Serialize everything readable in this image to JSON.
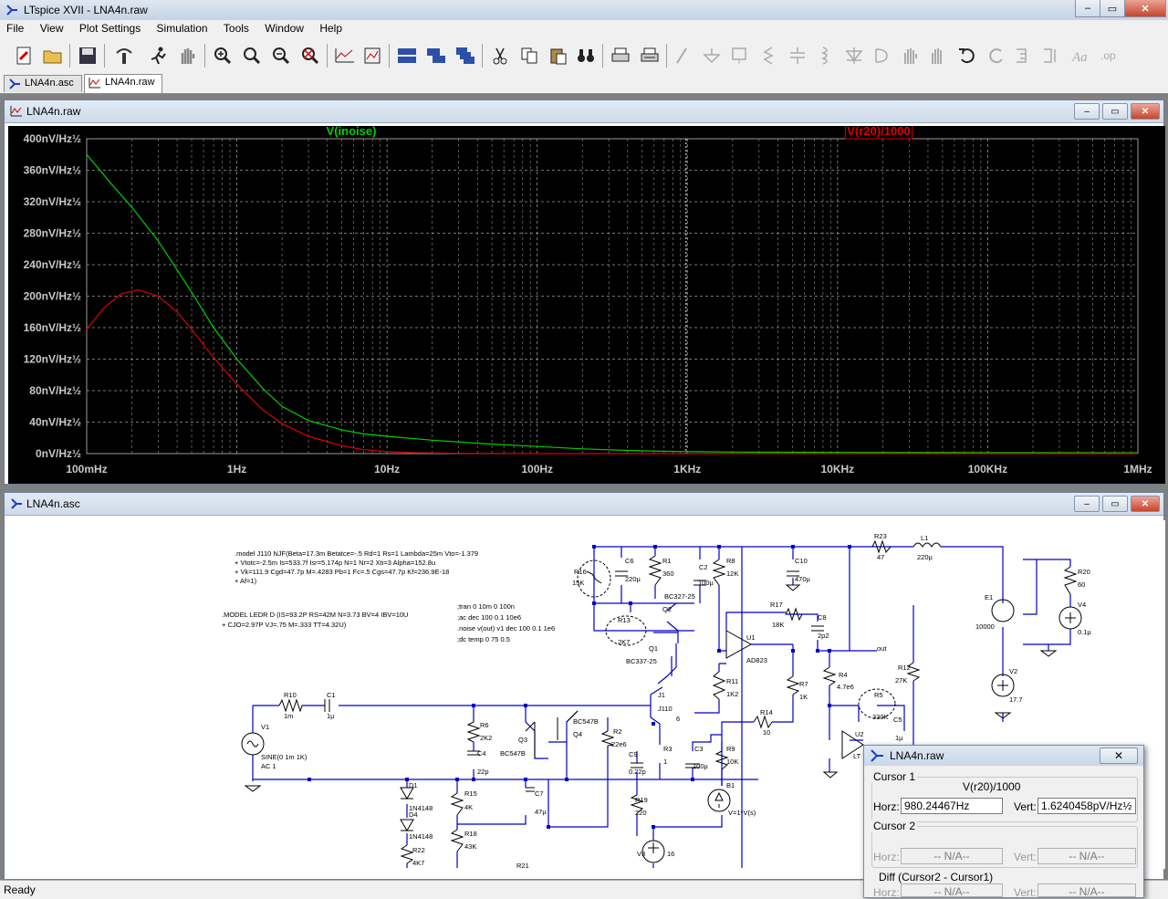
{
  "window": {
    "title": "LTspice XVII - LNA4n.raw",
    "min": "–",
    "max": "▭",
    "close": "✕"
  },
  "menu": [
    "File",
    "View",
    "Plot Settings",
    "Simulation",
    "Tools",
    "Window",
    "Help"
  ],
  "tabs": [
    {
      "label": "LNA4n.asc",
      "active": false
    },
    {
      "label": "LNA4n.raw",
      "active": true
    }
  ],
  "plot_window": {
    "title": "LNA4n.raw"
  },
  "schematic_window": {
    "title": "LNA4n.asc"
  },
  "chart_data": {
    "type": "line",
    "x_scale": "log",
    "xlim": [
      0.1,
      1000000
    ],
    "ylim": [
      0,
      400
    ],
    "x_ticks": [
      "100mHz",
      "1Hz",
      "10Hz",
      "100Hz",
      "1KHz",
      "10KHz",
      "100KHz",
      "1MHz"
    ],
    "x_tick_values": [
      0.1,
      1,
      10,
      100,
      1000,
      10000,
      100000,
      1000000
    ],
    "y_ticks": [
      "400nV/Hz½",
      "360nV/Hz½",
      "320nV/Hz½",
      "280nV/Hz½",
      "240nV/Hz½",
      "200nV/Hz½",
      "160nV/Hz½",
      "120nV/Hz½",
      "80nV/Hz½",
      "40nV/Hz½",
      "0nV/Hz½"
    ],
    "y_tick_values": [
      400,
      360,
      320,
      280,
      240,
      200,
      160,
      120,
      80,
      40,
      0
    ],
    "cursor_x": 980.24467,
    "grid": true,
    "series": [
      {
        "name": "V(inoise)",
        "color": "#00d000",
        "x": [
          0.1,
          0.15,
          0.2,
          0.3,
          0.5,
          0.7,
          1,
          1.5,
          2,
          3,
          5,
          7,
          10,
          20,
          50,
          100,
          200,
          500,
          1000,
          2000,
          10000,
          100000,
          1000000
        ],
        "y": [
          380,
          340,
          313,
          270,
          205,
          160,
          120,
          82,
          60,
          42,
          30,
          25,
          22,
          17,
          12,
          9,
          6,
          3.5,
          2.5,
          2,
          1.5,
          1.2,
          1
        ]
      },
      {
        "name": "V(r20)/1000",
        "color": "#e00000",
        "boxed": true,
        "x": [
          0.1,
          0.13,
          0.17,
          0.22,
          0.3,
          0.4,
          0.5,
          0.7,
          1,
          1.5,
          2,
          3,
          5,
          7,
          10,
          15,
          20,
          30,
          50,
          100,
          1000,
          1000000
        ],
        "y": [
          158,
          185,
          203,
          208,
          200,
          180,
          158,
          122,
          88,
          55,
          38,
          22,
          10,
          5,
          2.5,
          1.2,
          0.8,
          0.4,
          0.2,
          0.05,
          0,
          0
        ]
      }
    ]
  },
  "schematic": {
    "model_lines": [
      ".model J110 NJF(Beta=17.3m Betatce=-.5 Rd=1 Rs=1 Lambda=25m Vto=-1.379",
      "+ Vtotc=-2.5m Is=533.7f Isr=5.174p N=1 Nr=2 Xti=3 Alpha=152.8u",
      "+ Vk=111.9 Cgd=47.7p M=.4283 Pb=1 Fc=.5 Cgs=47.7p Kf=236.9E-18",
      "+ Af=1)"
    ],
    "diode_lines": [
      ".MODEL LEDR D (IS=93.2P RS=42M N=3.73 BV=4 IBV=10U",
      "+ CJO=2.97P VJ=.75 M=.333 TT=4.32U)"
    ],
    "directives": [
      ";tran 0 10m 0 100n",
      ";ac dec 100 0.1 10e6",
      ".noise v(out) v1 dec 100 0.1 1e6",
      ";dc temp 0 75 0.5"
    ],
    "labels": {
      "R23": "R23",
      "R23v": "47",
      "L1": "L1",
      "L1v": "220µ",
      "R20": "R20",
      "R20v": "60",
      "E1": "E1",
      "E1v": "10000",
      "V4": "V4",
      "V4v": "0.1µ",
      "V2": "V2",
      "V2v": "17.7",
      "R16": "R16",
      "R16v": "15K",
      "C6": "C6",
      "C6v": "220µ",
      "R1": "R1",
      "R1v": "360",
      "C2": "C2",
      "C2v": "100µ",
      "R8": "R8",
      "R8v": "12K",
      "C10": "C10",
      "C10v": "470µ",
      "Q2": "BC327-25",
      "Q2n": "Q2",
      "R17": "R17",
      "R17v": "18K",
      "C8": "C8",
      "C8v": "2p2",
      "R13": "R13",
      "R13v": "2K7",
      "Q1": "Q1",
      "Q1v": "BC337-25",
      "U1": "U1",
      "U1v": "AD823",
      "out": "out",
      "R4": "R4",
      "R4v": "4.7e6",
      "R12": "R12",
      "R12v": "27K",
      "R11": "R11",
      "R11v": "1K2",
      "R7": "R7",
      "R7v": "1K",
      "R5": "R5",
      "R5v": "330K",
      "C5": "C5",
      "C5v": "1µ",
      "R10": "R10",
      "R10v": "1m",
      "C1": "C1",
      "C1v": "1µ",
      "V1": "V1",
      "V1v": "SINE(0 1m 1K)",
      "V1ac": "AC 1",
      "R6": "R6",
      "R6v": "2K2",
      "C4": "C4",
      "C4v": "22p",
      "Q3": "Q3",
      "Q3v": "BC547B",
      "Q4": "Q4",
      "Q4v": "BC547B",
      "R2": "R2",
      "R2v": "22e6",
      "J1": "J1",
      "J1v": "J110",
      "n6": "6",
      "R14": "R14",
      "R14v": "10",
      "U2": "U2",
      "U2v": "LT",
      "R3": "R3",
      "R3v": "1",
      "C9": "C9",
      "C9v": "0.22p",
      "C3": "C3",
      "C3v": "100µ",
      "R9": "R9",
      "R9v": "10K",
      "B1": "B1",
      "B1v": "V=1*V(s)",
      "D1": "D1",
      "D1v": "1N4148",
      "D4": "D4",
      "D4v": "1N4148",
      "R15": "R15",
      "R15v": "4K",
      "C7": "C7",
      "C7v": "47µ",
      "R19": "R19",
      "R19v": "220",
      "R18": "R18",
      "R18v": "43K",
      "R22": "R22",
      "R22v": "4K7",
      "R21": "R21",
      "V3": "V3",
      "V3v": "16"
    }
  },
  "cursor_window": {
    "title": "LNA4n.raw",
    "close": "✕",
    "cursor1_label": "Cursor 1",
    "trace": "V(r20)/1000",
    "horz_label": "Horz:",
    "horz_value": "980.24467Hz",
    "vert_label": "Vert:",
    "vert_value": "1.6240458pV/Hz½",
    "cursor2_label": "Cursor 2",
    "na": "-- N/A--",
    "diff_label": "Diff (Cursor2 - Cursor1)"
  },
  "status": "Ready"
}
